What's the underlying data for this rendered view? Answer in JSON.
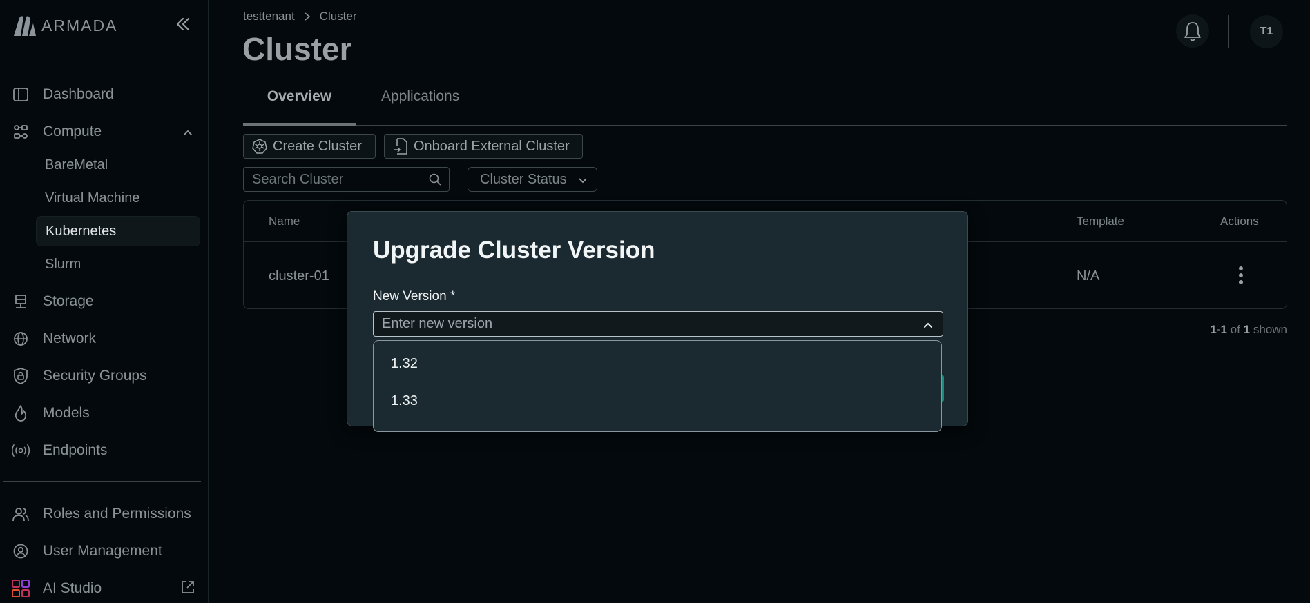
{
  "app": {
    "brand": "ARMADA"
  },
  "sidebar": {
    "items": [
      {
        "label": "Dashboard",
        "icon": "dashboard-icon"
      },
      {
        "label": "Compute",
        "icon": "compute-icon",
        "expanded": true
      },
      {
        "label": "Storage",
        "icon": "storage-icon"
      },
      {
        "label": "Network",
        "icon": "network-icon"
      },
      {
        "label": "Security Groups",
        "icon": "lock-icon"
      },
      {
        "label": "Models",
        "icon": "flame-icon"
      },
      {
        "label": "Endpoints",
        "icon": "broadcast-icon"
      },
      {
        "label": "Roles and Permissions",
        "icon": "users-icon"
      },
      {
        "label": "User Management",
        "icon": "user-gear-icon"
      },
      {
        "label": "AI Studio",
        "icon": "grid-icon",
        "external": true
      }
    ],
    "compute_children": [
      {
        "label": "BareMetal"
      },
      {
        "label": "Virtual Machine"
      },
      {
        "label": "Kubernetes",
        "active": true
      },
      {
        "label": "Slurm"
      }
    ]
  },
  "header": {
    "breadcrumb": [
      "testtenant",
      "Cluster"
    ],
    "title": "Cluster",
    "avatar_initials": "T1"
  },
  "tabs": [
    {
      "label": "Overview",
      "active": true
    },
    {
      "label": "Applications",
      "active": false
    }
  ],
  "toolbar": {
    "create_label": "Create Cluster",
    "onboard_label": "Onboard External Cluster",
    "search_placeholder": "Search Cluster",
    "status_filter_label": "Cluster Status"
  },
  "table": {
    "columns": [
      "Name",
      "Template",
      "Actions"
    ],
    "rows": [
      {
        "name": "cluster-01",
        "template": "N/A"
      }
    ]
  },
  "pagination": {
    "range": "1-1",
    "of": "of",
    "total": "1",
    "suffix": "shown"
  },
  "modal": {
    "title": "Upgrade Cluster Version",
    "field_label": "New Version *",
    "placeholder": "Enter new version",
    "options": [
      "1.32",
      "1.33"
    ]
  },
  "colors": {
    "background": "#03090c",
    "modal_background": "#1b2930",
    "accent_teal": "#1e8a7d"
  }
}
